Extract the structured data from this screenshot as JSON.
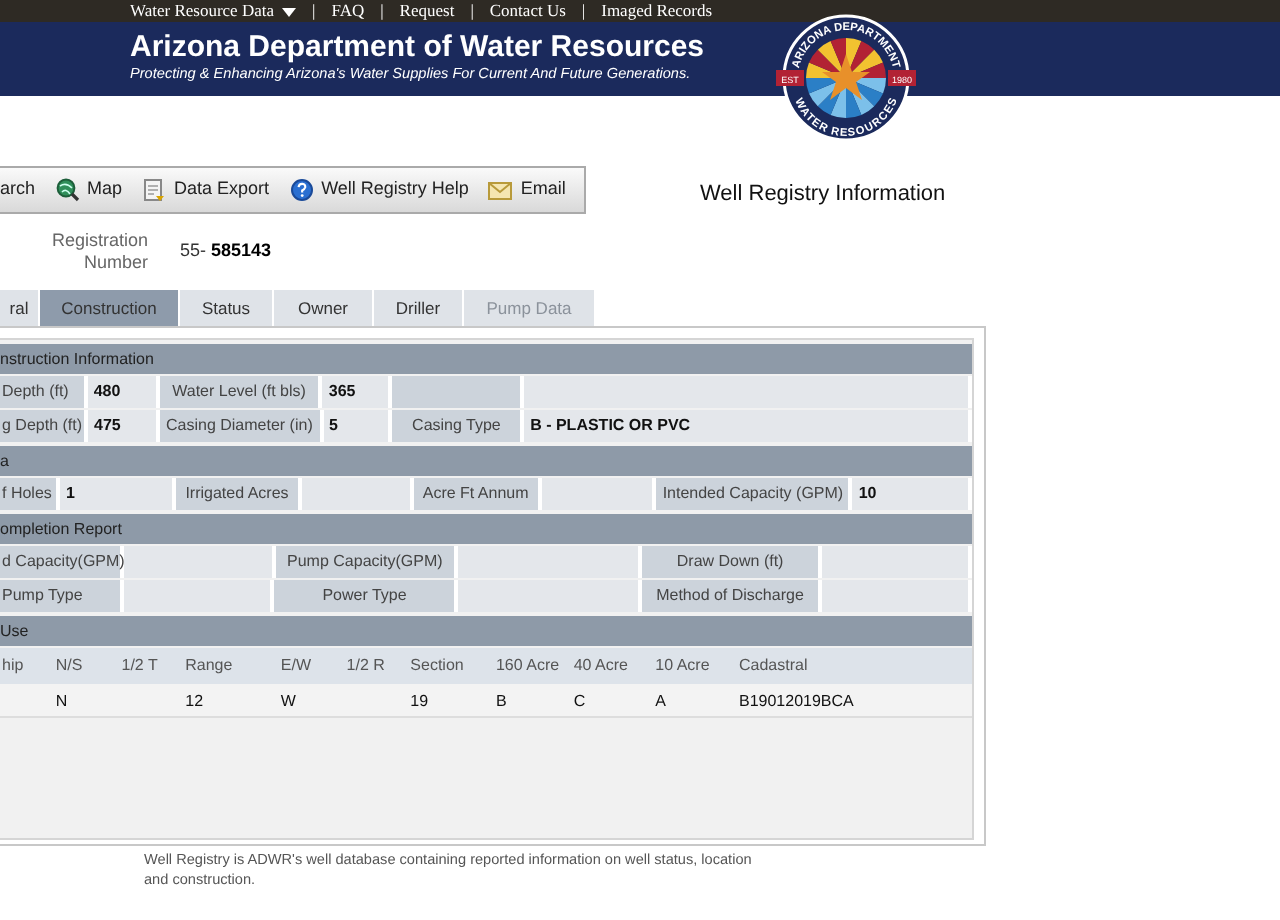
{
  "top_nav": [
    {
      "kind": "link",
      "label": "Water Resource Data",
      "dropdown": true
    },
    {
      "kind": "separator",
      "label": "|"
    },
    {
      "kind": "link",
      "label": "FAQ",
      "dropdown": false
    },
    {
      "kind": "separator",
      "label": "|"
    },
    {
      "kind": "link",
      "label": "Request",
      "dropdown": false
    },
    {
      "kind": "separator",
      "label": "|"
    },
    {
      "kind": "link",
      "label": "Contact Us",
      "dropdown": false
    },
    {
      "kind": "separator",
      "label": "|"
    },
    {
      "kind": "link",
      "label": "Imaged Records",
      "dropdown": false
    }
  ],
  "header": {
    "title": "Arizona Department of Water Resources",
    "tagline": "Protecting & Enhancing Arizona's Water Supplies For Current And Future Generations.",
    "seal": {
      "top_text": "ARIZONA DEPARTMENT",
      "bottom_text": "WATER RESOURCES",
      "left_text": "EST",
      "right_text": "1980"
    }
  },
  "toolbar": [
    {
      "label": "arch"
    },
    {
      "label": "Map"
    },
    {
      "label": "Data Export"
    },
    {
      "label": "Well Registry Help"
    },
    {
      "label": "Email"
    }
  ],
  "page_title": "Well Registry Information",
  "registration": {
    "label_lines": [
      "Registration",
      "Number"
    ],
    "prefix": "55-",
    "number": "585143"
  },
  "tabs": [
    {
      "label": "ral",
      "selected": false,
      "disabled": false
    },
    {
      "label": "Construction",
      "selected": true,
      "disabled": false
    },
    {
      "label": "Status",
      "selected": false,
      "disabled": false
    },
    {
      "label": "Owner",
      "selected": false,
      "disabled": false
    },
    {
      "label": "Driller",
      "selected": false,
      "disabled": false
    },
    {
      "label": "Pump Data",
      "selected": false,
      "disabled": true
    }
  ],
  "sections": [
    {
      "kind": "fields",
      "title": "nstruction Information",
      "rows": [
        [
          {
            "kind": "label",
            "text": "Depth (ft)"
          },
          {
            "kind": "value",
            "text": "480"
          },
          {
            "kind": "label",
            "text": "Water Level (ft bls)"
          },
          {
            "kind": "value",
            "text": "365"
          },
          {
            "kind": "label",
            "text": null
          },
          {
            "kind": "value",
            "text": null
          }
        ],
        [
          {
            "kind": "label",
            "text": "g Depth (ft)"
          },
          {
            "kind": "value",
            "text": "475"
          },
          {
            "kind": "label",
            "text": "Casing Diameter (in)"
          },
          {
            "kind": "value",
            "text": "5"
          },
          {
            "kind": "label",
            "text": "Casing Type"
          },
          {
            "kind": "value",
            "text": "B - PLASTIC OR PVC"
          }
        ]
      ]
    },
    {
      "kind": "fields",
      "title": "a",
      "rows": [
        [
          {
            "kind": "label",
            "text": "f Holes"
          },
          {
            "kind": "value",
            "text": "1"
          },
          {
            "kind": "label",
            "text": "Irrigated Acres"
          },
          {
            "kind": "value",
            "text": null
          },
          {
            "kind": "label",
            "text": "Acre Ft Annum"
          },
          {
            "kind": "value",
            "text": null
          },
          {
            "kind": "label",
            "text": "Intended Capacity (GPM)"
          },
          {
            "kind": "value",
            "text": "10"
          }
        ]
      ]
    },
    {
      "kind": "fields",
      "title": "ompletion Report",
      "rows": [
        [
          {
            "kind": "label",
            "text": "d Capacity(GPM)"
          },
          {
            "kind": "value",
            "text": null
          },
          {
            "kind": "label",
            "text": "Pump Capacity(GPM)"
          },
          {
            "kind": "value",
            "text": null
          },
          {
            "kind": "label",
            "text": "Draw Down (ft)"
          },
          {
            "kind": "value",
            "text": null
          }
        ],
        [
          {
            "kind": "label",
            "text": "Pump Type"
          },
          {
            "kind": "value",
            "text": null
          },
          {
            "kind": "label",
            "text": "Power Type"
          },
          {
            "kind": "value",
            "text": null
          },
          {
            "kind": "label",
            "text": "Method of Discharge"
          },
          {
            "kind": "value",
            "text": null
          }
        ]
      ]
    },
    {
      "kind": "table",
      "title": "Use",
      "columns": [
        "hip",
        "N/S",
        "1/2 T",
        "Range",
        "E/W",
        "1/2 R",
        "Section",
        "160 Acre",
        "40 Acre",
        "10 Acre",
        "Cadastral"
      ],
      "rows": [
        [
          null,
          "N",
          null,
          "12",
          "W",
          null,
          "19",
          "B",
          "C",
          "A",
          "B19012019BCA"
        ]
      ]
    }
  ],
  "footer_note": "Well Registry is ADWR's well database containing reported information on well status, location and construction."
}
